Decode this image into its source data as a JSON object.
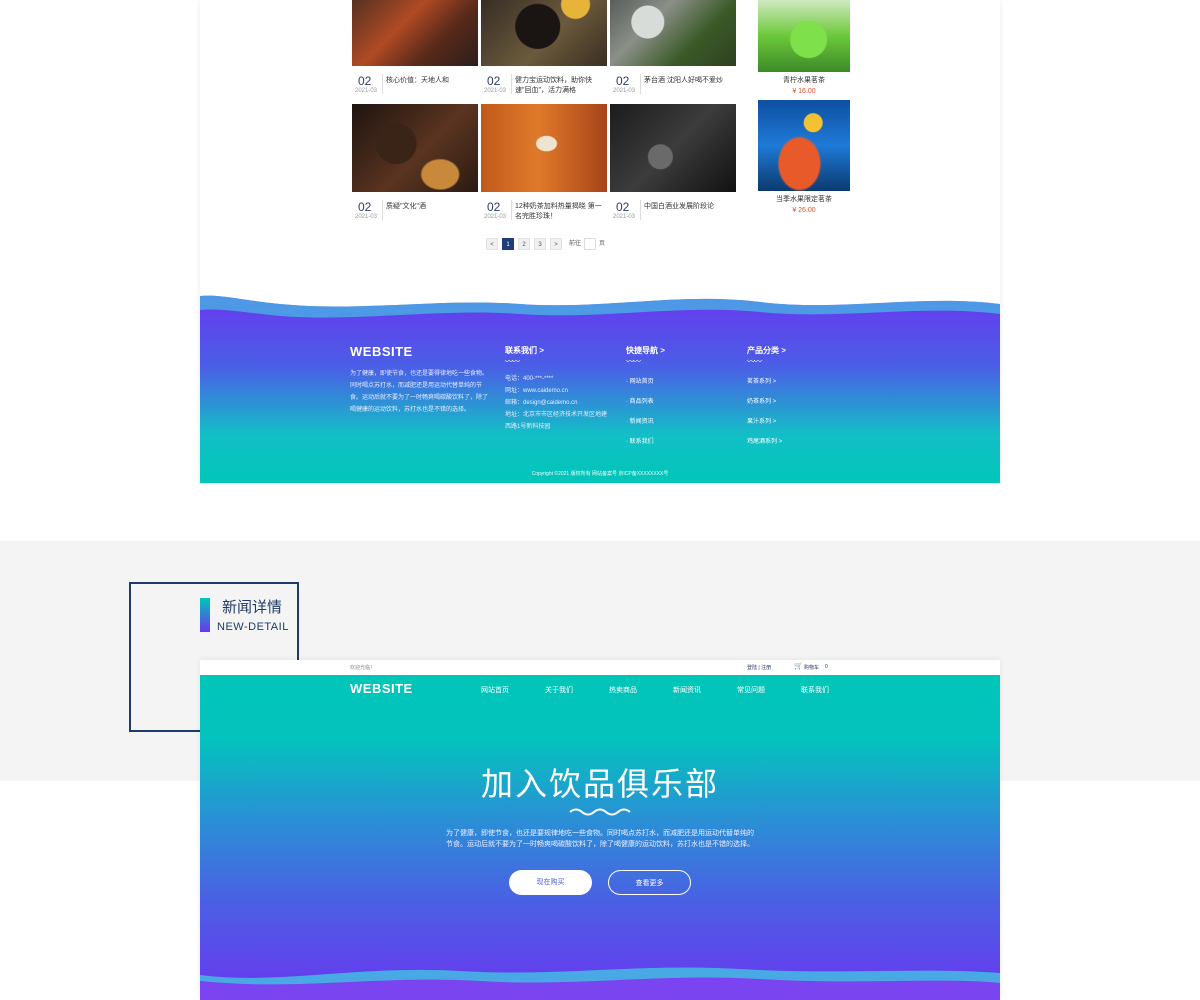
{
  "news": [
    {
      "day": "02",
      "date": "2021-03",
      "title": "核心价值：天地人和"
    },
    {
      "day": "02",
      "date": "2021-03",
      "title": "健力宝运动饮料，助你快速\"回血\"，活力满格"
    },
    {
      "day": "02",
      "date": "2021-03",
      "title": "茅台酒 沈阳人好喝不爱炒"
    },
    {
      "day": "02",
      "date": "2021-03",
      "title": "质疑\"文化\"酒"
    },
    {
      "day": "02",
      "date": "2021-03",
      "title": "12种奶茶加料热量揭晓 第一名完胜珍珠！"
    },
    {
      "day": "02",
      "date": "2021-03",
      "title": "中国白酒业发展阶段论"
    }
  ],
  "products": [
    {
      "name": "青柠水果茗茶",
      "price": "¥ 16.00"
    },
    {
      "name": "当季水果限定茗茶",
      "price": "¥ 26.00"
    }
  ],
  "pagination": {
    "prev": "<",
    "pages": [
      "1",
      "2",
      "3"
    ],
    "next": ">",
    "goto": "前往",
    "page_unit": "页"
  },
  "footer": {
    "logo": "WEBSITE",
    "about": "为了健康，即使节食，也还是要得律地吃一些食物。同时喝点苏打水，而减肥还是用运动代替单纯的节食。运动后就不要为了一时畅爽喝碳酸饮料了，除了喝健康的运动饮料，苏打水也是不错的选择。",
    "contact_title": "联系我们  >",
    "phone": "电话：400-***-****",
    "site": "网址：www.caidemo.cn",
    "email": "邮箱：design@caidemo.cn",
    "address": "地址：北京市市区经济技术开发区地建西路1号新科技园",
    "quick_title": "快捷导航  >",
    "quick": [
      "· 网站首页",
      "· 商品列表",
      "· 新闻资讯",
      "· 联系我们"
    ],
    "cat_title": "产品分类  >",
    "cats": [
      "茗茶系列 >",
      "奶茶系列 >",
      "果汁系列 >",
      "鸡尾酒系列 >"
    ],
    "copyright": "Copyright ©2021 版权所有 网站备案号 京ICP备XXXXXXXX号"
  },
  "tag": {
    "cn": "新闻详情",
    "en": "NEW-DETAIL"
  },
  "header2": {
    "welcome": "欢迎光临！",
    "login": "登陆 | 注册",
    "cart": "购物车",
    "cart_count": "0",
    "logo": "WEBSITE",
    "nav": [
      "网站首页",
      "关于我们",
      "热卖商品",
      "新闻资讯",
      "常见问题",
      "联系我们"
    ]
  },
  "hero": {
    "title": "加入饮品俱乐部",
    "desc1": "为了健康，即使节食，也还是要规律地吃一些食物。同时喝点苏打水，而减肥还是用运动代替单纯的",
    "desc2": "节食。运动后就不要为了一时畅爽喝碳酸饮料了，除了喝健康的运动饮料，苏打水也是不错的选择。",
    "buy": "现在购买",
    "more": "查看更多"
  },
  "colors": {
    "navy": "#1e3a66",
    "teal": "#00c6b8",
    "purple": "#6a36f0",
    "price": "#e0502a"
  }
}
